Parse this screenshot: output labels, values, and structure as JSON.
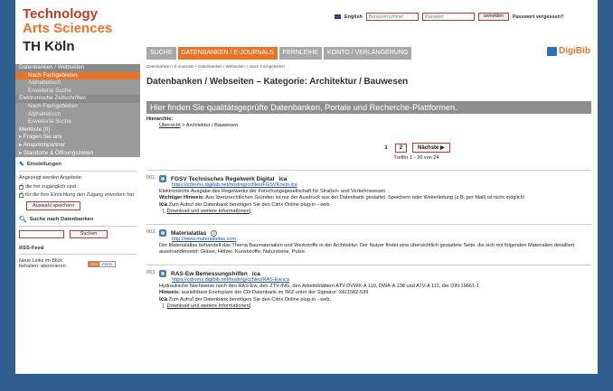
{
  "header": {
    "logo_line1": "Technology",
    "logo_line2": "Arts Sciences",
    "logo_line3": "TH Köln",
    "language": "English",
    "username_placeholder": "Benutzernummer",
    "password_placeholder": "Passwort",
    "login_button": "anmelden",
    "forgot_link": "Passwort vergessen?"
  },
  "nav": {
    "tabs": [
      "SUCHE",
      "DATENBANKEN / E-JOURNALS",
      "FERNLEIHE",
      "KONTO / VERLÄNGERUNG"
    ],
    "active_index": 1,
    "brand": "DigiBib"
  },
  "sidebar": {
    "items": [
      {
        "label": "Datenbanken / Webseiten",
        "kind": "head"
      },
      {
        "label": "Nach Fachgebieten",
        "kind": "active"
      },
      {
        "label": "Alphabetisch",
        "kind": "sub"
      },
      {
        "label": "Erweiterte Suche",
        "kind": "sub"
      },
      {
        "label": "Elektronische Zeitschriften",
        "kind": "head"
      },
      {
        "label": "Nach Fachgebieten",
        "kind": "sub"
      },
      {
        "label": "Alphabetisch",
        "kind": "sub"
      },
      {
        "label": "Erweiterte Suche",
        "kind": "sub"
      },
      {
        "label": "Merkliste [0]",
        "kind": "plain"
      },
      {
        "label": "Fragen Sie uns",
        "kind": "arrow"
      },
      {
        "label": "Ansprechpartner",
        "kind": "arrow"
      },
      {
        "label": "Standorte & Öffnungszeiten",
        "kind": "arrow"
      }
    ],
    "settings_title": "Einstellungen",
    "settings_intro": "Angezeigt werden Angebote:",
    "opt_free": "die frei zugänglich sind",
    "opt_inst": "für die Ihre Einrichtung den Zugang erworben hat",
    "save_button": "Auswahl speichern",
    "search_title": "Suche nach Datenbanken",
    "search_button": "Suchen",
    "rss_title": "RSS-Feed",
    "rss_text": "Neue Links im Blick behalten: abonnieren.",
    "rss_badge_a": "RSS",
    "rss_badge_b": "FEED"
  },
  "main": {
    "breadcrumb": "Datenbanken / E-Journals > Datenbanken / Webseiten > Nach Fachgebieten",
    "title": "Datenbanken / Webseiten – Kategorie: Architektur / Bauwesen",
    "banner": "Hier finden Sie qualitätsgeprüfte Datenbanken, Portale und Recherche-Plattformen.",
    "hier_label": "Hierarchie:",
    "hier_link": "Übersicht",
    "hier_rest": " > Architektur / Bauwesen",
    "pages": [
      "1",
      "2"
    ],
    "next_label": "Nächste ▶",
    "hits": "Treffer 1 - 20 von 24"
  },
  "entries": [
    {
      "num": "001.",
      "title": "FGSV Technisches Regelwerk Digital",
      "badge": "ica",
      "url": "https://cdroms.digibib.net/hosting/ccfiles/FGSVKoeln.ica",
      "desc": "Elektronische Ausgabe des Regelwerks der Forschungsgesellschaft für Straßen- und Verkehrswesen.",
      "hint_label": "Wichtiger Hinweis:",
      "hint": " Aus lizenzrechtlichen Gründen ist nur der Ausdruck aus der Datenbank gestattet. Speichern oder Weiterleitung (z.B. per Mail) ist nicht möglich!",
      "citrix": " Zum Aufruf der Datenbank benötigen Sie den Citrix Online plug-in - web.",
      "download": "Download und weitere Informationen"
    },
    {
      "num": "002.",
      "title": "Materialatlas",
      "badge": "",
      "url": "http://www.materialatlas.com",
      "desc": "Der Materialatlas behandelt das Thema Baumaterialien und Werkstoffe in der Architektur. Der Nutzer findet eine übersichtlich gestaltete Seite, die sich mit folgenden Materialien detailliert auseinandersetzt: Gläser, Hölzer, Kunststoffe, Natursteine, Putze.",
      "hint_label": "",
      "hint": "",
      "citrix": "",
      "download": ""
    },
    {
      "num": "003.",
      "title": "RAS-Ew Bemessungshilfen",
      "badge": "ica",
      "url": "https://cdroms.digibib.net/hosting/ccfiles/RAS-Ew.ica",
      "desc": "Hydraulische Nachweise nach den RAS-Ew, den ZTV-ING, den Arbeitsblättern ATV-DVWK-A 110, DWA-A 138 und ATV-A 111, der DIN 19661-1",
      "hint_label": "Hinweis:",
      "hint": " ausleihbare Exemplare der CD-Datenbank im WIZ unter der Signatur: XEI1582-539",
      "citrix": " Zum Aufruf der Datenbank benötigen Sie den Citrix Online plug-in - web.",
      "download": "Download und weitere Informationen"
    }
  ]
}
